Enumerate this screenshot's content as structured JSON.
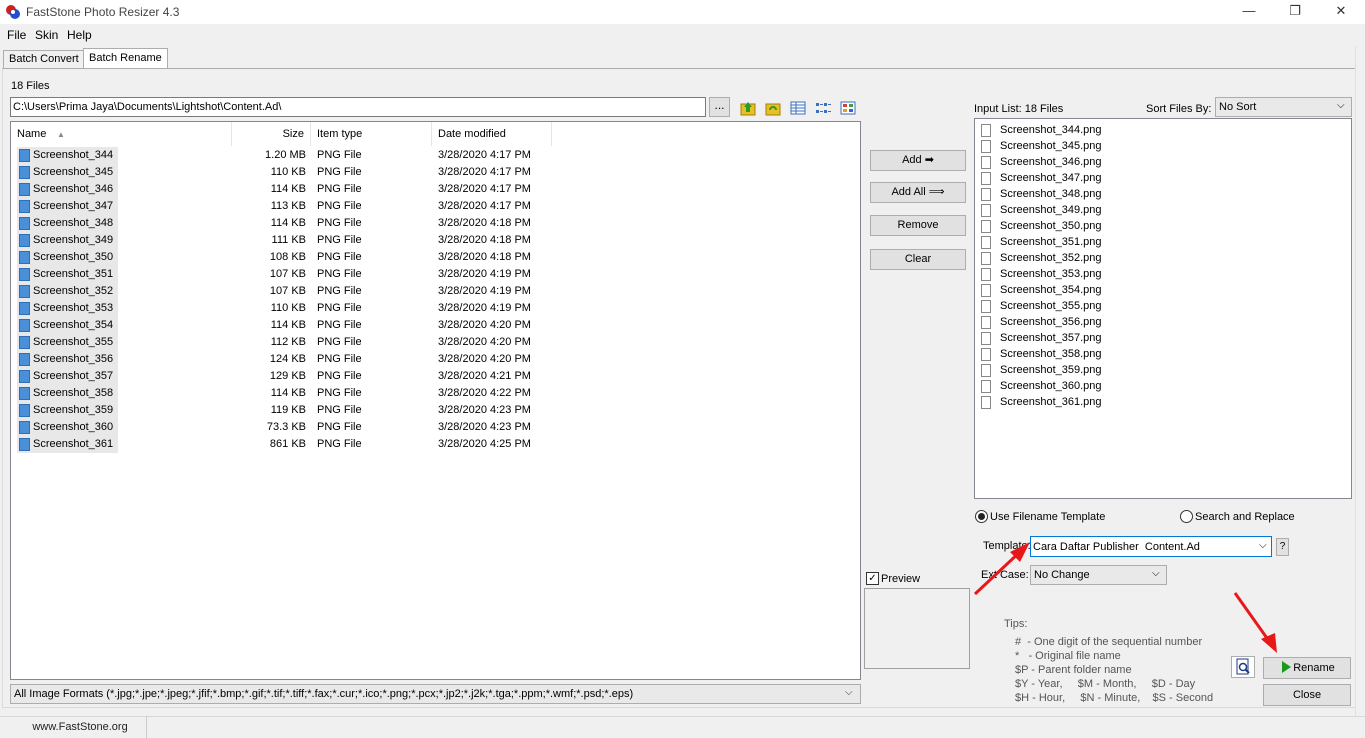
{
  "window": {
    "title": "FastStone Photo Resizer 4.3",
    "controls": {
      "minimize": "—",
      "maximize": "❐",
      "close": "✕"
    }
  },
  "menu": {
    "file": "File",
    "skin": "Skin",
    "help": "Help"
  },
  "tabs": {
    "batch_convert": "Batch Convert",
    "batch_rename": "Batch Rename"
  },
  "source": {
    "files_count": "18 Files",
    "path": "C:\\Users\\Prima Jaya\\Documents\\Lightshot\\Content.Ad\\",
    "browse_label": "..."
  },
  "file_list": {
    "columns": {
      "name": "Name",
      "size": "Size",
      "type": "Item type",
      "date": "Date modified"
    },
    "rows": [
      {
        "name": "Screenshot_344",
        "size": "1.20 MB",
        "type": "PNG File",
        "date": "3/28/2020 4:17 PM"
      },
      {
        "name": "Screenshot_345",
        "size": "110 KB",
        "type": "PNG File",
        "date": "3/28/2020 4:17 PM"
      },
      {
        "name": "Screenshot_346",
        "size": "114 KB",
        "type": "PNG File",
        "date": "3/28/2020 4:17 PM"
      },
      {
        "name": "Screenshot_347",
        "size": "113 KB",
        "type": "PNG File",
        "date": "3/28/2020 4:17 PM"
      },
      {
        "name": "Screenshot_348",
        "size": "114 KB",
        "type": "PNG File",
        "date": "3/28/2020 4:18 PM"
      },
      {
        "name": "Screenshot_349",
        "size": "111 KB",
        "type": "PNG File",
        "date": "3/28/2020 4:18 PM"
      },
      {
        "name": "Screenshot_350",
        "size": "108 KB",
        "type": "PNG File",
        "date": "3/28/2020 4:18 PM"
      },
      {
        "name": "Screenshot_351",
        "size": "107 KB",
        "type": "PNG File",
        "date": "3/28/2020 4:19 PM"
      },
      {
        "name": "Screenshot_352",
        "size": "107 KB",
        "type": "PNG File",
        "date": "3/28/2020 4:19 PM"
      },
      {
        "name": "Screenshot_353",
        "size": "110 KB",
        "type": "PNG File",
        "date": "3/28/2020 4:19 PM"
      },
      {
        "name": "Screenshot_354",
        "size": "114 KB",
        "type": "PNG File",
        "date": "3/28/2020 4:20 PM"
      },
      {
        "name": "Screenshot_355",
        "size": "112 KB",
        "type": "PNG File",
        "date": "3/28/2020 4:20 PM"
      },
      {
        "name": "Screenshot_356",
        "size": "124 KB",
        "type": "PNG File",
        "date": "3/28/2020 4:20 PM"
      },
      {
        "name": "Screenshot_357",
        "size": "129 KB",
        "type": "PNG File",
        "date": "3/28/2020 4:21 PM"
      },
      {
        "name": "Screenshot_358",
        "size": "114 KB",
        "type": "PNG File",
        "date": "3/28/2020 4:22 PM"
      },
      {
        "name": "Screenshot_359",
        "size": "119 KB",
        "type": "PNG File",
        "date": "3/28/2020 4:23 PM"
      },
      {
        "name": "Screenshot_360",
        "size": "73.3 KB",
        "type": "PNG File",
        "date": "3/28/2020 4:23 PM"
      },
      {
        "name": "Screenshot_361",
        "size": "861 KB",
        "type": "PNG File",
        "date": "3/28/2020 4:25 PM"
      }
    ]
  },
  "format_filter": "All Image Formats (*.jpg;*.jpe;*.jpeg;*.jfif;*.bmp;*.gif;*.tif;*.tiff;*.fax;*.cur;*.ico;*.png;*.pcx;*.jp2;*.j2k;*.tga;*.ppm;*.wmf;*.psd;*.eps)",
  "actions": {
    "add": "Add",
    "add_all": "Add All",
    "remove": "Remove",
    "clear": "Clear"
  },
  "preview": {
    "label": "Preview",
    "checked": true
  },
  "input_list": {
    "label": "Input List:  18 Files",
    "sort_label": "Sort Files By:",
    "sort_value": "No Sort",
    "items": [
      "Screenshot_344.png",
      "Screenshot_345.png",
      "Screenshot_346.png",
      "Screenshot_347.png",
      "Screenshot_348.png",
      "Screenshot_349.png",
      "Screenshot_350.png",
      "Screenshot_351.png",
      "Screenshot_352.png",
      "Screenshot_353.png",
      "Screenshot_354.png",
      "Screenshot_355.png",
      "Screenshot_356.png",
      "Screenshot_357.png",
      "Screenshot_358.png",
      "Screenshot_359.png",
      "Screenshot_360.png",
      "Screenshot_361.png"
    ]
  },
  "rename_options": {
    "use_template": "Use Filename Template",
    "search_replace": "Search and Replace",
    "template_label": "Template:",
    "template_value": "Cara Daftar Publisher  Content.Ad",
    "help": "?",
    "ext_case_label": "Ext Case:",
    "ext_case_value": "No Change"
  },
  "tips": {
    "title": "Tips:",
    "lines": [
      "#  - One digit of the sequential number",
      "*   - Original file name",
      "$P - Parent folder name",
      "$Y - Year,     $M - Month,     $D - Day",
      "$H - Hour,     $N - Minute,    $S - Second"
    ]
  },
  "buttons": {
    "rename": "Rename",
    "close": "Close"
  },
  "status": {
    "url": "www.FastStone.org"
  },
  "colors": {
    "accent": "#0078d7",
    "play": "#1a9a1a",
    "file_icon": "#4a90d9"
  }
}
